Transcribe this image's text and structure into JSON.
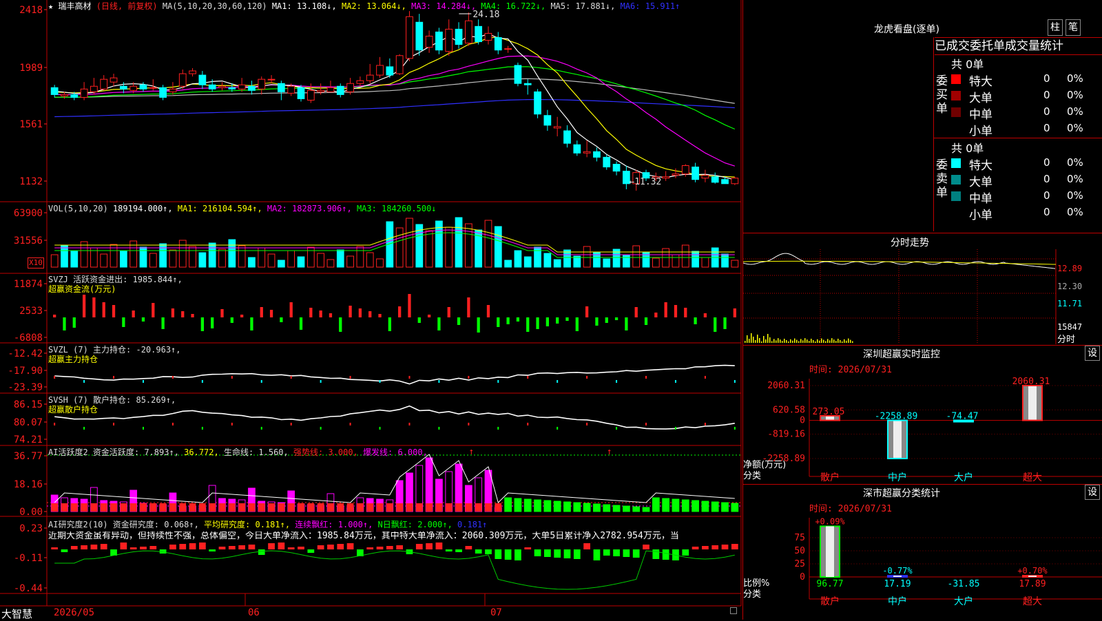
{
  "stock": {
    "star": "★",
    "name": "瑞丰高材",
    "period": "(日线, 前复权)"
  },
  "bottom": {
    "brand": "大智慧",
    "date_labels": [
      "2026/05",
      "06",
      "07"
    ]
  },
  "colors": {
    "up": "#ff2020",
    "down": "#00ffff",
    "ma1": "#ffffff",
    "ma2": "#ffff00",
    "ma3": "#ff00ff",
    "ma4": "#00ff00",
    "ma5": "#c0c0c0",
    "ma6": "#3030ff",
    "grid": "#c00000"
  },
  "panels": {
    "price": {
      "legend": [
        {
          "t": "MA(5,10,20,30,60,120)",
          "c": "#dddddd"
        },
        {
          "t": "MA1: 13.108↓,",
          "c": "#ffffff"
        },
        {
          "t": "MA2: 13.064↓,",
          "c": "#ffff00"
        },
        {
          "t": "MA3: 14.284↓,",
          "c": "#ff00ff"
        },
        {
          "t": "MA4: 16.722↓,",
          "c": "#00ff00"
        },
        {
          "t": "MA5: 17.881↓,",
          "c": "#dddddd"
        },
        {
          "t": "MA6: 15.911↑",
          "c": "#3030ff"
        }
      ],
      "ticks": [
        "2418",
        "1989",
        "1561",
        "1132"
      ],
      "high_label": "24.18",
      "low_label": "←11.32"
    },
    "vol": {
      "legend": [
        {
          "t": "VOL(5,10,20)",
          "c": "#dddddd"
        },
        {
          "t": "189194.000↑,",
          "c": "#ffffff"
        },
        {
          "t": "MA1: 216104.594↑,",
          "c": "#ffff00"
        },
        {
          "t": "MA2: 182873.906↑,",
          "c": "#ff00ff"
        },
        {
          "t": "MA3: 184260.500↓",
          "c": "#00ff00"
        }
      ],
      "ticks": [
        "63900",
        "31556"
      ],
      "unit": "X10"
    },
    "svzj": {
      "legend": [
        {
          "t": "SVZJ  活跃资金进出: 1985.844↑,",
          "c": "#dddddd"
        }
      ],
      "sub": "超赢资金流(万元)",
      "ticks": [
        "11874",
        "2533",
        "-6808"
      ]
    },
    "svzl": {
      "legend": [
        {
          "t": "SVZL (7) 主力持仓: -20.963↑,",
          "c": "#dddddd"
        }
      ],
      "sub": "超赢主力持仓",
      "ticks": [
        "-12.42",
        "-17.90",
        "-23.39"
      ]
    },
    "svsh": {
      "legend": [
        {
          "t": "SVSH (7) 散户持仓: 85.269↑,",
          "c": "#dddddd"
        }
      ],
      "sub": "超赢散户持仓",
      "ticks": [
        "86.15",
        "80.07",
        "74.21"
      ]
    },
    "ai1": {
      "legend": [
        {
          "t": "AI活跃度2 资金活跃度: 7.893↑,",
          "c": "#dddddd"
        },
        {
          "t": "36.772,",
          "c": "#ffff00"
        },
        {
          "t": "生命线: 1.560,",
          "c": "#dddddd"
        },
        {
          "t": "强势线: 3.000,",
          "c": "#ff2020"
        },
        {
          "t": "爆发线: 6.000,",
          "c": "#ff00ff"
        }
      ],
      "ticks": [
        "36.77",
        "18.16",
        "0.00"
      ]
    },
    "ai2": {
      "legend": [
        {
          "t": "AI研究度2(10) 资金研究度: 0.068↑,",
          "c": "#dddddd"
        },
        {
          "t": "平均研究度: 0.181↑,",
          "c": "#ffff00"
        },
        {
          "t": "连续飘红: 1.000↑,",
          "c": "#ff00ff"
        },
        {
          "t": "N日飘红: 2.000↑,",
          "c": "#00ff00"
        },
        {
          "t": "0.181↑",
          "c": "#3030ff"
        }
      ],
      "note": "近期大资金虽有异动，但持续性不强，总体偏空，今日大单净流入：1985.84万元，其中特大单净流入：2060.309万元，大单5日累计净入2782.954万元，当",
      "ticks": [
        "0.23",
        "-0.11",
        "-0.44"
      ]
    }
  },
  "dragon": {
    "title": "龙虎看盘(逐单)",
    "btn_bar": "柱",
    "btn_pen": "笔",
    "tabs": [
      "已成交",
      "委托单",
      "成交量统计"
    ],
    "buy": {
      "label": "委买单",
      "count": "共 0单",
      "rows": [
        {
          "name": "特大",
          "v": "0",
          "p": "0%",
          "c": "#ff0000"
        },
        {
          "name": "大单",
          "v": "0",
          "p": "0%",
          "c": "#a00000"
        },
        {
          "name": "中单",
          "v": "0",
          "p": "0%",
          "c": "#700000"
        },
        {
          "name": "小单",
          "v": "0",
          "p": "0%",
          "c": ""
        }
      ]
    },
    "sell": {
      "label": "委卖单",
      "count": "共 0单",
      "rows": [
        {
          "name": "特大",
          "v": "0",
          "p": "0%",
          "c": "#00ffff"
        },
        {
          "name": "大单",
          "v": "0",
          "p": "0%",
          "c": "#008c8c"
        },
        {
          "name": "中单",
          "v": "0",
          "p": "0%",
          "c": "#008080"
        },
        {
          "name": "小单",
          "v": "0",
          "p": "0%",
          "c": ""
        }
      ]
    }
  },
  "intraday": {
    "title": "分时走势",
    "ticks": [
      "12.89",
      "12.30",
      "11.71"
    ],
    "vol_tick": "15847",
    "vol_tag": "分时"
  },
  "sz_monitor": {
    "title": "深圳超赢实时监控",
    "settings_btn": "设",
    "time": "时间: 2026/07/31",
    "yticks": [
      "2060.31",
      "620.58",
      "0",
      "-819.16",
      "-2258.89"
    ],
    "ylabel": "净额(万元)",
    "xlabel": "分类",
    "categories": [
      "散户",
      "中户",
      "大户",
      "超大"
    ],
    "values": [
      273.05,
      -2258.89,
      -74.47,
      2060.31
    ],
    "value_labels": [
      "273.05",
      "-2258.89",
      "-74.47",
      "2060.31"
    ]
  },
  "sz_class": {
    "title": "深市超赢分类统计",
    "settings_btn": "设",
    "time": "时间: 2026/07/31",
    "yticks": [
      "75",
      "50",
      "25",
      "0"
    ],
    "ylabel": "比例%",
    "xlabel": "分类",
    "categories": [
      "散户",
      "中户",
      "大户",
      "超大"
    ],
    "top_labels": [
      "+0.09%",
      "-0.77%",
      "",
      "+0.70%"
    ],
    "values": [
      96.77,
      17.19,
      -31.85,
      17.89
    ],
    "value_labels": [
      "96.77",
      "17.19",
      "-31.85",
      "17.89"
    ]
  },
  "chart_data": {
    "type": "candlestick",
    "dates_month_starts": [
      "2026/05",
      "06",
      "07"
    ],
    "candles": [
      [
        18.7,
        18.2,
        18.9,
        18.0
      ],
      [
        18.1,
        18.2,
        18.4,
        17.9
      ],
      [
        18.2,
        18.0,
        18.4,
        17.8
      ],
      [
        18.0,
        18.6,
        19.1,
        17.8
      ],
      [
        18.4,
        18.8,
        19.4,
        18.2
      ],
      [
        18.6,
        19.3,
        19.6,
        18.5
      ],
      [
        19.1,
        19.4,
        19.7,
        18.8
      ],
      [
        18.8,
        18.6,
        19.1,
        18.3
      ],
      [
        18.5,
        18.8,
        19.1,
        18.3
      ],
      [
        18.9,
        18.6,
        19.1,
        18.4
      ],
      [
        18.7,
        18.7,
        19.3,
        18.5
      ],
      [
        18.7,
        18.0,
        18.9,
        17.8
      ],
      [
        18.4,
        18.6,
        19.1,
        18.2
      ],
      [
        18.8,
        19.7,
        20.0,
        18.6
      ],
      [
        19.7,
        19.9,
        20.1,
        19.5
      ],
      [
        19.6,
        18.9,
        19.9,
        18.6
      ],
      [
        18.9,
        18.6,
        19.3,
        18.4
      ],
      [
        18.7,
        18.8,
        19.1,
        18.5
      ],
      [
        18.7,
        18.6,
        19.0,
        18.4
      ],
      [
        18.6,
        18.9,
        19.4,
        18.4
      ],
      [
        18.8,
        18.5,
        19.2,
        18.2
      ],
      [
        18.6,
        19.3,
        19.5,
        18.2
      ],
      [
        19.3,
        19.3,
        19.6,
        19.0
      ],
      [
        19.0,
        18.4,
        19.2,
        17.8
      ],
      [
        18.3,
        18.8,
        19.0,
        18.1
      ],
      [
        18.7,
        17.9,
        18.9,
        17.7
      ],
      [
        17.8,
        18.5,
        19.0,
        17.6
      ],
      [
        18.4,
        18.5,
        19.0,
        18.2
      ],
      [
        18.4,
        18.7,
        19.2,
        18.4
      ],
      [
        18.8,
        18.2,
        19.0,
        18.0
      ],
      [
        18.4,
        19.0,
        19.4,
        18.2
      ],
      [
        19.0,
        19.2,
        19.5,
        18.8
      ],
      [
        19.2,
        19.6,
        20.4,
        19.0
      ],
      [
        19.6,
        20.3,
        20.9,
        19.4
      ],
      [
        20.2,
        19.6,
        20.8,
        19.4
      ],
      [
        19.7,
        21.0,
        21.1,
        19.6
      ],
      [
        20.8,
        23.8,
        24.2,
        20.6
      ],
      [
        23.4,
        21.4,
        24.0,
        21.0
      ],
      [
        21.6,
        22.4,
        22.8,
        21.2
      ],
      [
        22.7,
        21.4,
        23.0,
        21.1
      ],
      [
        21.3,
        22.9,
        23.6,
        21.0
      ],
      [
        22.9,
        21.8,
        23.4,
        21.5
      ],
      [
        21.9,
        23.5,
        24.1,
        21.7
      ],
      [
        23.1,
        22.0,
        23.6,
        21.8
      ],
      [
        22.1,
        22.6,
        23.1,
        21.8
      ],
      [
        22.3,
        21.4,
        22.7,
        21.1
      ],
      [
        21.5,
        21.5,
        21.7,
        21.2
      ],
      [
        20.3,
        19.0,
        20.5,
        18.8
      ],
      [
        19.0,
        18.9,
        19.3,
        18.2
      ],
      [
        18.4,
        16.8,
        18.6,
        16.5
      ],
      [
        16.7,
        16.0,
        17.1,
        15.6
      ],
      [
        15.8,
        15.9,
        16.6,
        15.2
      ],
      [
        15.6,
        14.7,
        16.0,
        14.4
      ],
      [
        14.6,
        14.0,
        14.9,
        13.8
      ],
      [
        14.0,
        14.1,
        14.9,
        13.7
      ],
      [
        14.1,
        13.7,
        14.4,
        13.4
      ],
      [
        13.7,
        13.0,
        13.9,
        12.8
      ],
      [
        13.2,
        12.7,
        13.4,
        12.4
      ],
      [
        12.7,
        11.8,
        13.1,
        11.4
      ],
      [
        11.8,
        12.6,
        12.8,
        11.3
      ],
      [
        12.6,
        12.2,
        12.8,
        12.0
      ],
      [
        12.2,
        12.3,
        12.6,
        12.0
      ],
      [
        12.2,
        12.3,
        12.7,
        12.0
      ],
      [
        12.4,
        12.5,
        12.9,
        12.2
      ],
      [
        12.5,
        13.1,
        13.2,
        12.3
      ],
      [
        13.0,
        12.1,
        13.3,
        11.9
      ],
      [
        12.2,
        12.4,
        12.8,
        11.9
      ],
      [
        12.3,
        11.9,
        12.6,
        11.8
      ],
      [
        12.1,
        11.8,
        12.3,
        11.8
      ],
      [
        11.8,
        12.2,
        12.3,
        11.7
      ]
    ],
    "vol_up": [
      1,
      0,
      0,
      1,
      1,
      1,
      1,
      0,
      1,
      0,
      1,
      0,
      1,
      1,
      1,
      0,
      0,
      1,
      0,
      1,
      0,
      1,
      1,
      0,
      1,
      0,
      1,
      1,
      1,
      0,
      1,
      1,
      1,
      1,
      0,
      1,
      1,
      0,
      1,
      0,
      1,
      0,
      1,
      0,
      1,
      0,
      0,
      0,
      0,
      0,
      0,
      0,
      0,
      0,
      1,
      0,
      0,
      0,
      0,
      1,
      0,
      1,
      1,
      1,
      1,
      0,
      1,
      0,
      0,
      1
    ]
  }
}
